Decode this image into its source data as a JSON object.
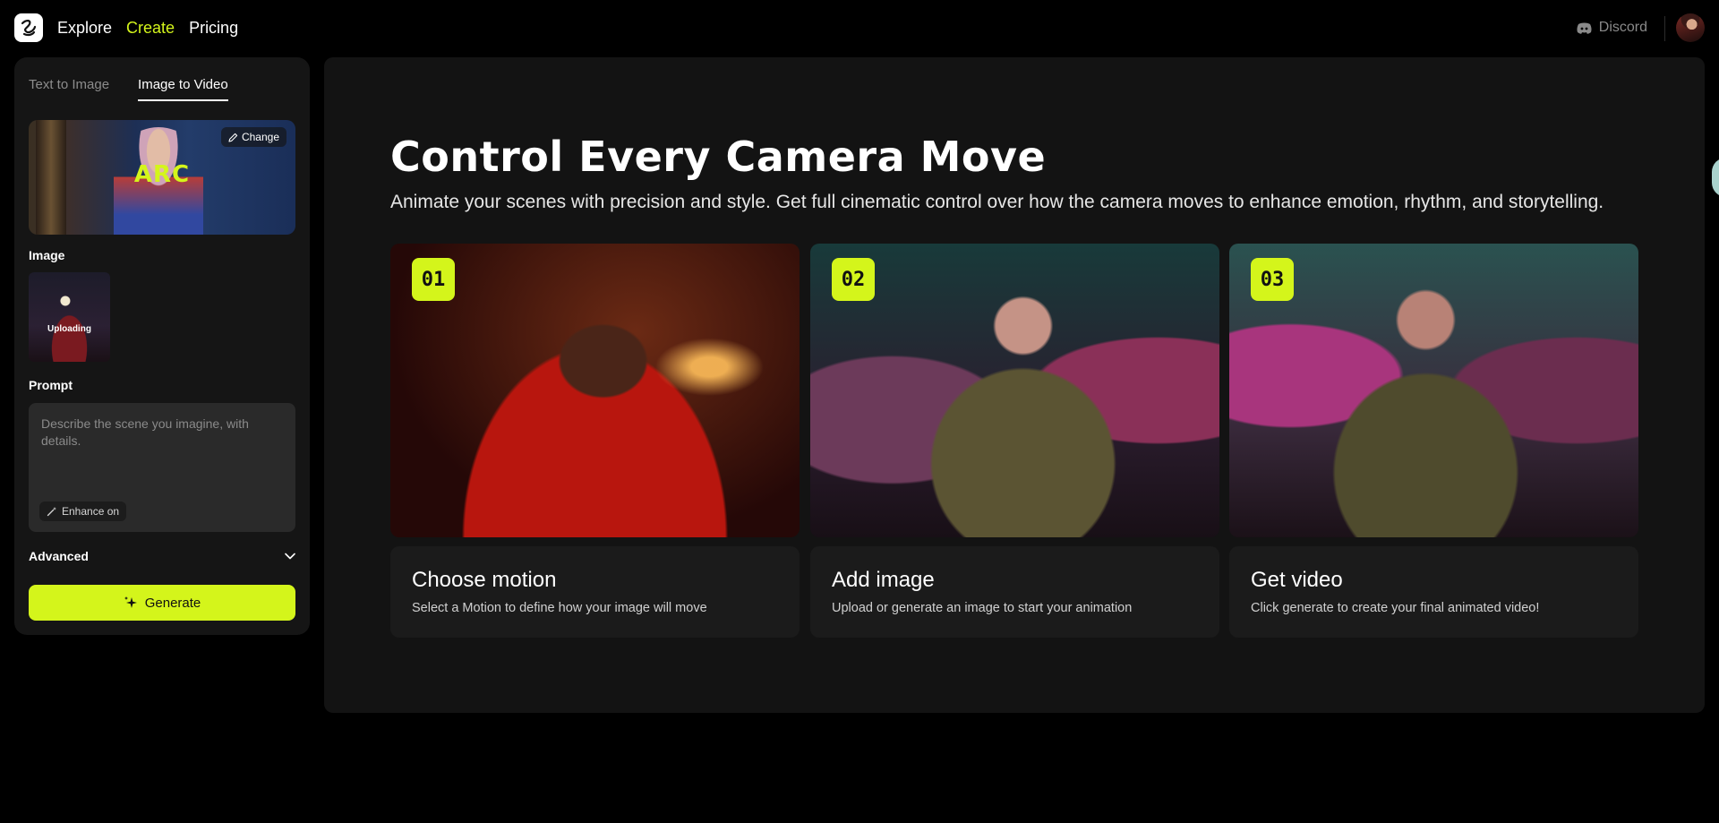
{
  "nav": {
    "items": [
      {
        "label": "Explore"
      },
      {
        "label": "Create"
      },
      {
        "label": "Pricing"
      }
    ],
    "active_index": 1,
    "discord_label": "Discord"
  },
  "sidebar": {
    "tabs": [
      {
        "label": "Text to Image"
      },
      {
        "label": "Image to Video"
      }
    ],
    "active_tab": 1,
    "preview_card": {
      "title": "ARC",
      "change_label": "Change"
    },
    "image_label": "Image",
    "image_status": "Uploading",
    "prompt_label": "Prompt",
    "prompt_placeholder": "Describe the scene you imagine, with details.",
    "prompt_value": "",
    "enhance_label": "Enhance on",
    "advanced_label": "Advanced",
    "generate_label": "Generate"
  },
  "main": {
    "title": "Control Every Camera Move",
    "subtitle": "Animate your scenes with precision and style. Get full cinematic control over how the camera moves to enhance emotion, rhythm, and storytelling.",
    "steps": [
      {
        "number": "01",
        "title": "Choose motion",
        "description": "Select a Motion to define how your image will move"
      },
      {
        "number": "02",
        "title": "Add image",
        "description": "Upload or generate an image to start your animation"
      },
      {
        "number": "03",
        "title": "Get video",
        "description": "Click generate to create your final animated video!"
      }
    ]
  },
  "colors": {
    "accent": "#d4f51b",
    "background": "#000000",
    "panel": "#151515",
    "main_panel": "#131313"
  },
  "icons": {
    "logo": "brand-logo-icon",
    "discord": "discord-icon",
    "change": "pencil-icon",
    "enhance": "magic-wand-icon",
    "advanced": "chevron-down-icon",
    "generate": "sparkles-icon"
  }
}
